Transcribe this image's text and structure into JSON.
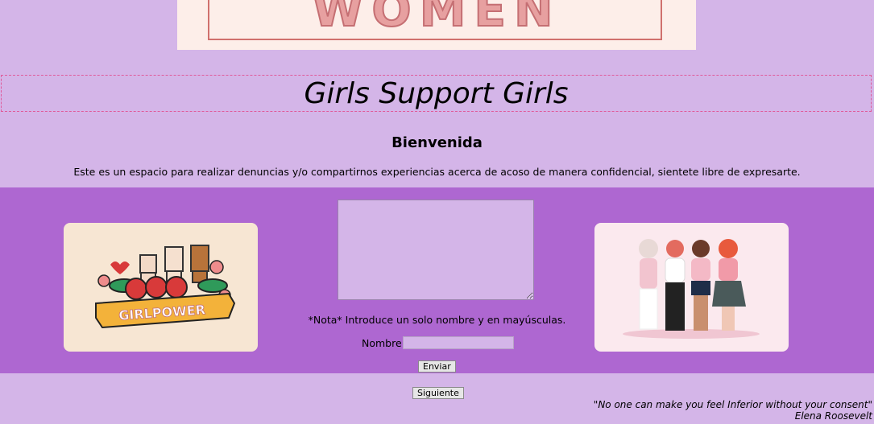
{
  "banner": {
    "word": "WOMEN"
  },
  "header": {
    "title": "Girls Support Girls"
  },
  "welcome": {
    "heading": "Bienvenida",
    "text": "Este es un espacio para realizar denuncias y/o compartirnos experiencias acerca de acoso de manera confidencial, sientete libre de expresarte."
  },
  "form": {
    "textarea_value": "",
    "note": "*Nota* Introduce un solo nombre y en mayúsculas.",
    "name_label": "Nombre",
    "name_value": "",
    "submit_label": "Enviar",
    "next_label": "Siguiente"
  },
  "images": {
    "left_text": "GIRLPOWER"
  },
  "quote": {
    "text": "\"No one can make you feel Inferior without your consent\"",
    "author": "Elena Roosevelt"
  },
  "colors": {
    "page_bg": "#d4b5e8",
    "band_bg": "#ae67d1",
    "title_border": "#e05a9a"
  }
}
